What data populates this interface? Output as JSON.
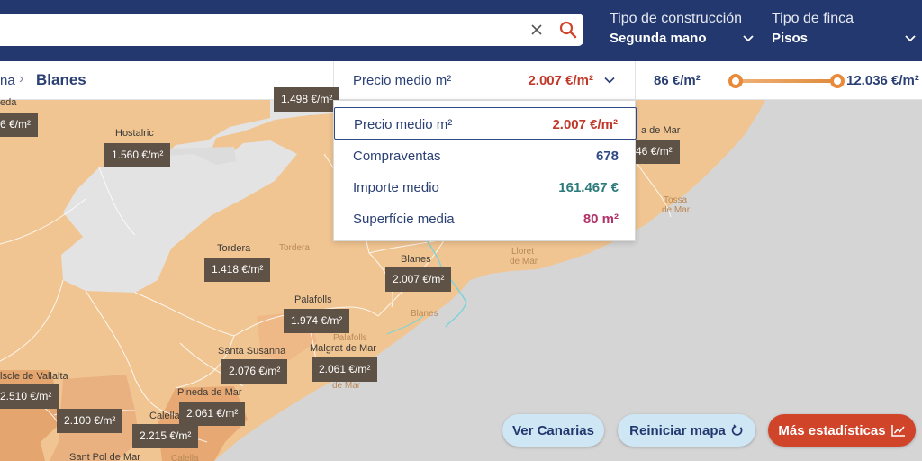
{
  "header": {
    "search": {
      "value": "",
      "placeholder": ""
    },
    "filters": [
      {
        "label": "Tipo de construcción",
        "value": "Segunda mano"
      },
      {
        "label": "Tipo de finca",
        "value": "Pisos"
      }
    ]
  },
  "breadcrumb": {
    "previous": "na",
    "separator": "›",
    "current": "Blanes"
  },
  "metric_selector": {
    "label": "Precio medio m²",
    "value": "2.007 €/m²"
  },
  "range": {
    "min_label": "86 €/m²",
    "max_label": "12.036 €/m²"
  },
  "dropdown": {
    "items": [
      {
        "label": "Precio medio m²",
        "value": "2.007 €/m²",
        "color": "#c0392b",
        "selected": true
      },
      {
        "label": "Compraventas",
        "value": "678",
        "color": "#2f4a86"
      },
      {
        "label": "Importe medio",
        "value": "161.467 €",
        "color": "#2c7a7b"
      },
      {
        "label": "Superfície media",
        "value": "80 m²",
        "color": "#b0336a"
      }
    ]
  },
  "map": {
    "towns": [
      {
        "name": "eda"
      },
      {
        "name": "Hostalric"
      },
      {
        "name": "a de Mar"
      },
      {
        "name": "Tordera"
      },
      {
        "name": "Tordera"
      },
      {
        "name": "Blanes"
      },
      {
        "name": "Palafolls"
      },
      {
        "name": "Palafolls"
      },
      {
        "name": "Santa Susanna"
      },
      {
        "name": "Malgrat de Mar"
      },
      {
        "name": "lscle de Vallalta"
      },
      {
        "name": "Pineda de Mar"
      },
      {
        "name": "Calella"
      },
      {
        "name": "Sant Pol de Mar"
      },
      {
        "name": "Lloret"
      },
      {
        "name": "de Mar"
      },
      {
        "name": "Tossa"
      },
      {
        "name": "de Mar"
      },
      {
        "name": "Blanes"
      },
      {
        "name": "de Mar"
      },
      {
        "name": "Calella"
      }
    ],
    "prices": [
      {
        "value": "6 €/m²"
      },
      {
        "value": "1.560 €/m²"
      },
      {
        "value": "1.498 €/m²"
      },
      {
        "value": "46 €/m²"
      },
      {
        "value": "1.418 €/m²"
      },
      {
        "value": "2.007 €/m²"
      },
      {
        "value": "1.974 €/m²"
      },
      {
        "value": "2.076 €/m²"
      },
      {
        "value": "2.061 €/m²"
      },
      {
        "value": "2.510 €/m²"
      },
      {
        "value": "2.100 €/m²"
      },
      {
        "value": "2.061 €/m²"
      },
      {
        "value": "2.215 €/m²"
      }
    ]
  },
  "buttons": {
    "canarias": "Ver Canarias",
    "reset": "Reiniciar mapa",
    "stats": "Más estadísticas"
  },
  "icons": {
    "clear": "close-icon",
    "search": "search-icon",
    "chevron": "chevron-down-icon",
    "reset": "refresh-icon",
    "stats": "line-chart-icon"
  },
  "colors": {
    "header": "#23386e",
    "map_land": "#f1c592",
    "map_sea": "#d5d5d5",
    "accent": "#d0442a",
    "light_button": "#cfe6f5"
  }
}
